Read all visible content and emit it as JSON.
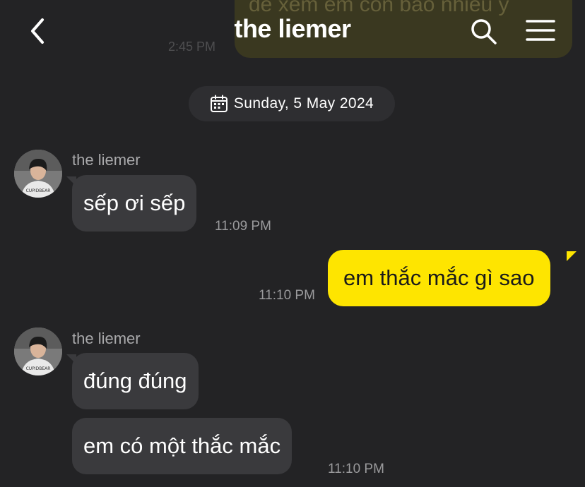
{
  "previous_message": {
    "text": "để xem em còn bao nhiêu ý",
    "time": "2:45 PM"
  },
  "header": {
    "title": "the liemer"
  },
  "date_separator": "Sunday, 5 May 2024",
  "messages": [
    {
      "sender": "the liemer",
      "avatar_text": "CUPIDBEAR",
      "bubbles": [
        "sếp ơi sếp"
      ],
      "time": "11:09 PM"
    },
    {
      "sender": "me",
      "bubbles": [
        "em thắc mắc gì sao"
      ],
      "time": "11:10 PM"
    },
    {
      "sender": "the liemer",
      "avatar_text": "CUPIDBEAR",
      "bubbles": [
        "đúng đúng",
        "em có một thắc mắc"
      ],
      "time": "11:10 PM"
    }
  ],
  "colors": {
    "background": "#232325",
    "incoming_bubble": "#3a3a3d",
    "outgoing_bubble": "#fee500",
    "timestamp": "#9a9a9c"
  }
}
